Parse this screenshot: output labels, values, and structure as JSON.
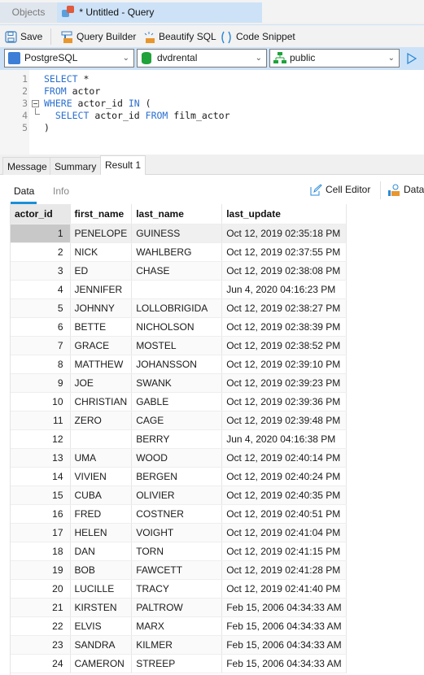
{
  "tabs": {
    "objects": "Objects",
    "query": "* Untitled - Query"
  },
  "toolbar": {
    "save": "Save",
    "query_builder": "Query Builder",
    "beautify": "Beautify SQL",
    "snippet": "Code Snippet"
  },
  "selectors": {
    "connection": "PostgreSQL",
    "database": "dvdrental",
    "schema": "public"
  },
  "editor": {
    "lines": [
      {
        "n": "1",
        "text": "SELECT *"
      },
      {
        "n": "2",
        "text": "FROM actor"
      },
      {
        "n": "3",
        "text": "WHERE actor_id IN ("
      },
      {
        "n": "4",
        "text": "  SELECT actor_id FROM film_actor"
      },
      {
        "n": "5",
        "text": ")"
      }
    ]
  },
  "result_tabs": [
    "Message",
    "Summary",
    "Result 1"
  ],
  "subtabs": {
    "data": "Data",
    "info": "Info"
  },
  "result_tools": {
    "cell_editor": "Cell Editor",
    "data": "Data"
  },
  "grid": {
    "columns": [
      "actor_id",
      "first_name",
      "last_name",
      "last_update"
    ],
    "rows": [
      [
        "1",
        "PENELOPE",
        "GUINESS",
        "Oct 12, 2019 02:35:18 PM"
      ],
      [
        "2",
        "NICK",
        "WAHLBERG",
        "Oct 12, 2019 02:37:55 PM"
      ],
      [
        "3",
        "ED",
        "CHASE",
        "Oct 12, 2019 02:38:08 PM"
      ],
      [
        "4",
        "JENNIFER",
        "",
        "Jun 4, 2020 04:16:23 PM"
      ],
      [
        "5",
        "JOHNNY",
        "LOLLOBRIGIDA",
        "Oct 12, 2019 02:38:27 PM"
      ],
      [
        "6",
        "BETTE",
        "NICHOLSON",
        "Oct 12, 2019 02:38:39 PM"
      ],
      [
        "7",
        "GRACE",
        "MOSTEL",
        "Oct 12, 2019 02:38:52 PM"
      ],
      [
        "8",
        "MATTHEW",
        "JOHANSSON",
        "Oct 12, 2019 02:39:10 PM"
      ],
      [
        "9",
        "JOE",
        "SWANK",
        "Oct 12, 2019 02:39:23 PM"
      ],
      [
        "10",
        "CHRISTIAN",
        "GABLE",
        "Oct 12, 2019 02:39:36 PM"
      ],
      [
        "11",
        "ZERO",
        "CAGE",
        "Oct 12, 2019 02:39:48 PM"
      ],
      [
        "12",
        "",
        "BERRY",
        "Jun 4, 2020 04:16:38 PM"
      ],
      [
        "13",
        "UMA",
        "WOOD",
        "Oct 12, 2019 02:40:14 PM"
      ],
      [
        "14",
        "VIVIEN",
        "BERGEN",
        "Oct 12, 2019 02:40:24 PM"
      ],
      [
        "15",
        "CUBA",
        "OLIVIER",
        "Oct 12, 2019 02:40:35 PM"
      ],
      [
        "16",
        "FRED",
        "COSTNER",
        "Oct 12, 2019 02:40:51 PM"
      ],
      [
        "17",
        "HELEN",
        "VOIGHT",
        "Oct 12, 2019 02:41:04 PM"
      ],
      [
        "18",
        "DAN",
        "TORN",
        "Oct 12, 2019 02:41:15 PM"
      ],
      [
        "19",
        "BOB",
        "FAWCETT",
        "Oct 12, 2019 02:41:28 PM"
      ],
      [
        "20",
        "LUCILLE",
        "TRACY",
        "Oct 12, 2019 02:41:40 PM"
      ],
      [
        "21",
        "KIRSTEN",
        "PALTROW",
        "Feb 15, 2006 04:34:33 AM"
      ],
      [
        "22",
        "ELVIS",
        "MARX",
        "Feb 15, 2006 04:34:33 AM"
      ],
      [
        "23",
        "SANDRA",
        "KILMER",
        "Feb 15, 2006 04:34:33 AM"
      ],
      [
        "24",
        "CAMERON",
        "STREEP",
        "Feb 15, 2006 04:34:33 AM"
      ]
    ]
  },
  "colors": {
    "accent": "#1a8fd6",
    "keyword": "#2a6fd0",
    "tab_active": "#cde2f7"
  }
}
